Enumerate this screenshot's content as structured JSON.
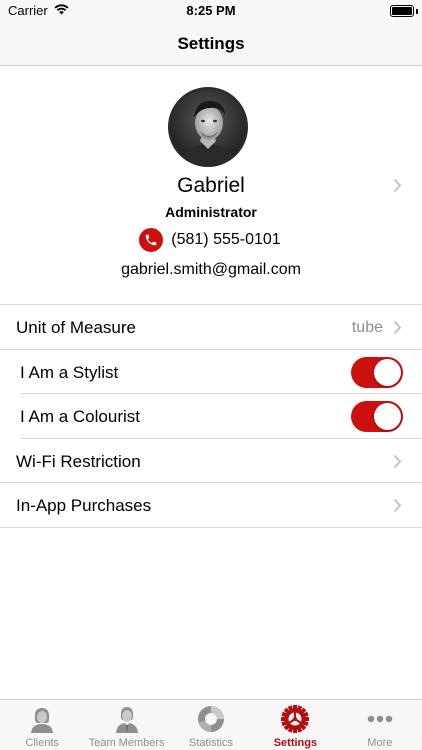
{
  "status_bar": {
    "carrier": "Carrier",
    "time": "8:25 PM"
  },
  "nav": {
    "title": "Settings"
  },
  "profile": {
    "name": "Gabriel",
    "role": "Administrator",
    "phone": "(581) 555-0101",
    "email": "gabriel.smith@gmail.com"
  },
  "settings": {
    "unit_of_measure": {
      "label": "Unit of Measure",
      "value": "tube"
    },
    "stylist": {
      "label": "I Am a Stylist",
      "on": true
    },
    "colourist": {
      "label": "I Am a Colourist",
      "on": true
    },
    "wifi": {
      "label": "Wi-Fi Restriction"
    },
    "purchases": {
      "label": "In-App Purchases"
    }
  },
  "tabs": [
    {
      "label": "Clients",
      "icon": "client-icon",
      "active": false
    },
    {
      "label": "Team Members",
      "icon": "team-members-icon",
      "active": false
    },
    {
      "label": "Statistics",
      "icon": "statistics-icon",
      "active": false
    },
    {
      "label": "Settings",
      "icon": "settings-gear-icon",
      "active": true
    },
    {
      "label": "More",
      "icon": "more-icon",
      "active": false
    }
  ],
  "colors": {
    "accent": "#cc1010",
    "tab_active": "#b30f0f",
    "tab_inactive": "#8e8e93"
  }
}
